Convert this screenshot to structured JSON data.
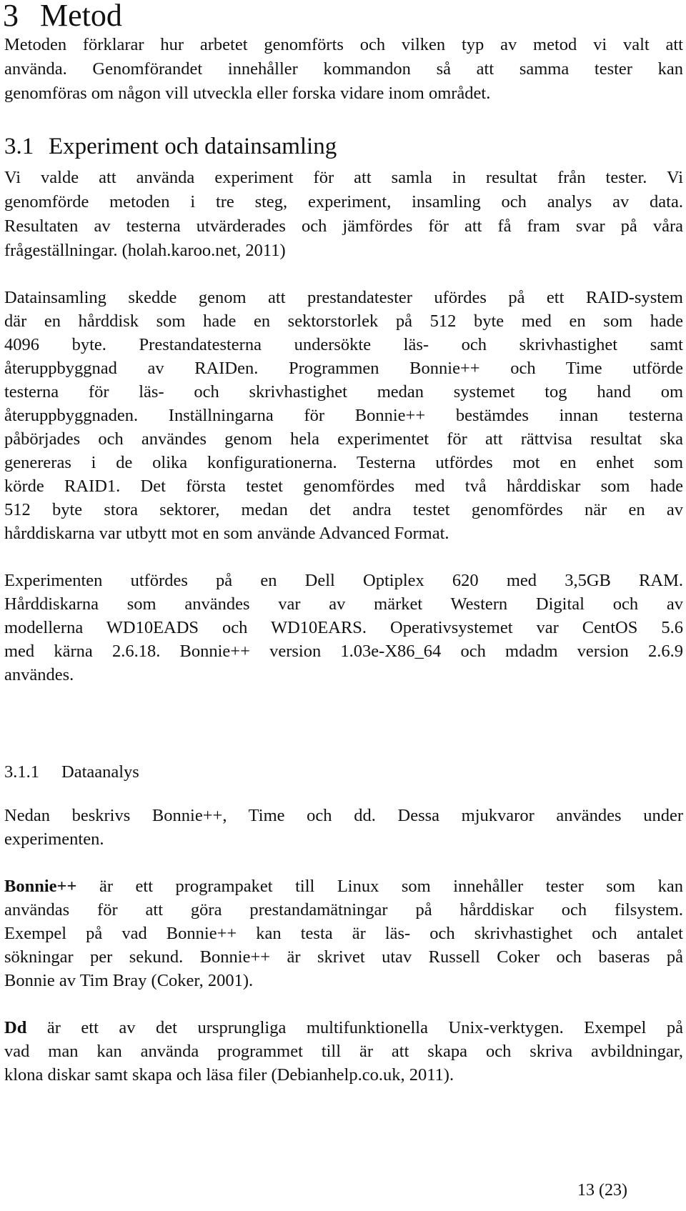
{
  "heading1": {
    "number": "3",
    "title": "Metod"
  },
  "intro": [
    "Metoden förklarar hur arbetet genomförts och vilken typ av metod vi valt att",
    "använda. Genomförandet innehåller kommandon så att samma tester kan",
    "genomföras om någon vill utveckla eller forska vidare inom området."
  ],
  "heading2": {
    "number": "3.1",
    "title": "Experiment och datainsamling"
  },
  "para1": [
    "Vi valde att använda experiment för att samla in resultat från tester. Vi",
    "genomförde metoden i tre steg, experiment, insamling och analys av data.",
    "Resultaten av testerna utvärderades och jämfördes för att få fram svar på våra",
    "frågeställningar. (holah.karoo.net, 2011)"
  ],
  "para2": [
    "Datainsamling skedde genom att prestandatester ufördes på ett RAID-system",
    "där en hårddisk som hade en sektorstorlek på 512 byte med en som hade",
    "4096 byte. Prestandatesterna undersökte läs- och skrivhastighet samt",
    "återuppbyggnad av RAIDen. Programmen Bonnie++ och Time utförde",
    "testerna för läs- och skrivhastighet medan systemet tog hand om",
    "återuppbyggnaden. Inställningarna för Bonnie++ bestämdes innan testerna",
    "påbörjades och användes genom hela experimentet för att rättvisa resultat ska",
    "genereras i de olika konfigurationerna. Testerna utfördes mot en enhet som",
    "körde RAID1. Det första testet genomfördes med två hårddiskar som hade",
    "512 byte stora sektorer, medan det andra testet genomfördes när en av",
    "hårddiskarna var utbytt mot en som använde Advanced Format."
  ],
  "para3": [
    "Experimenten utfördes på en Dell Optiplex 620 med 3,5GB RAM.",
    "Hårddiskarna som användes var av märket Western Digital och av",
    "modellerna WD10EADS och WD10EARS. Operativsystemet var CentOS 5.6",
    "med kärna 2.6.18. Bonnie++ version 1.03e-X86_64 och mdadm version 2.6.9",
    "användes."
  ],
  "heading3": {
    "number": "3.1.1",
    "title": "Dataanalys"
  },
  "para4": [
    "Nedan beskrivs Bonnie++, Time och dd. Dessa mjukvaror användes under",
    "experimenten."
  ],
  "para5": {
    "term": "Bonnie++",
    "lines": [
      " är ett programpaket till Linux som innehåller tester som kan",
      "användas för att göra prestandamätningar på hårddiskar och filsystem.",
      "Exempel på vad Bonnie++ kan testa är läs- och skrivhastighet och antalet",
      "sökningar per sekund. Bonnie++ är skrivet utav Russell Coker och baseras på",
      "Bonnie av Tim Bray (Coker, 2001)."
    ]
  },
  "para6": {
    "term": "Dd",
    "lines": [
      " är ett av det ursprungliga multifunktionella Unix-verktygen. Exempel på",
      "vad man kan använda programmet till är att skapa och skriva avbildningar,",
      "klona diskar samt skapa och läsa filer (Debianhelp.co.uk, 2011)."
    ]
  },
  "footer": {
    "page": "13 (23)"
  }
}
